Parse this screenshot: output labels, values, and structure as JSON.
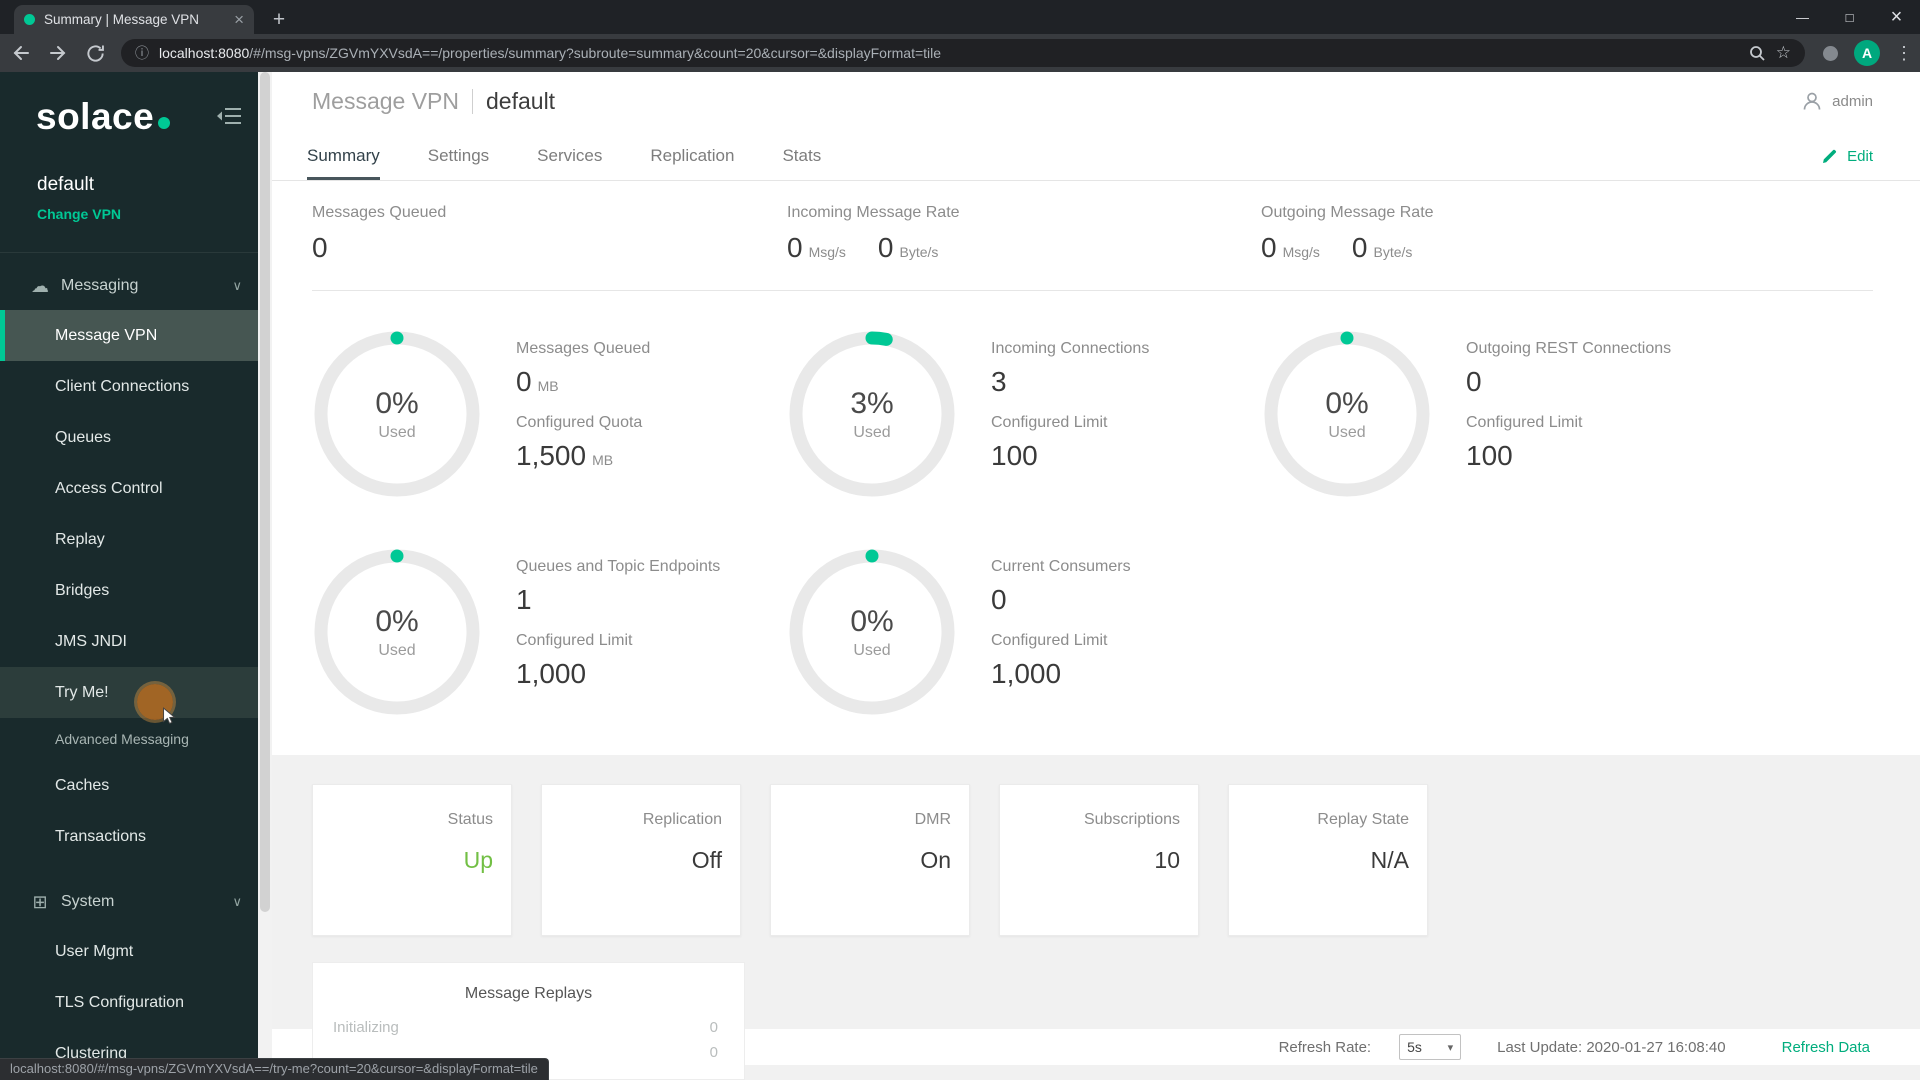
{
  "browser": {
    "tab_title": "Summary | Message VPN",
    "url_host": "localhost:8080",
    "url_path": "/#/msg-vpns/ZGVmYXVsdA==/properties/summary?subroute=summary&count=20&cursor=&displayFormat=tile",
    "avatar_letter": "A",
    "status_link": "localhost:8080/#/msg-vpns/ZGVmYXVsdA==/try-me?count=20&cursor=&displayFormat=tile"
  },
  "icons": {
    "close": "×",
    "plus": "+",
    "minimize": "—",
    "maximize": "□",
    "star": "☆",
    "menu": "⋮",
    "info": "ⓘ",
    "chevron_down": "∨",
    "cloud": "☁",
    "system_grid": "⊞",
    "dropdown_arrow": "▾"
  },
  "colors": {
    "accent": "#00c895",
    "status_up": "#72bf44"
  },
  "sidebar": {
    "logo_text": "solace",
    "vpn_name": "default",
    "change_vpn": "Change VPN",
    "messaging": {
      "label": "Messaging",
      "items": [
        "Message VPN",
        "Client Connections",
        "Queues",
        "Access Control",
        "Replay",
        "Bridges",
        "JMS JNDI",
        "Try Me!"
      ],
      "subheader": "Advanced Messaging",
      "items2": [
        "Caches",
        "Transactions"
      ]
    },
    "system": {
      "label": "System",
      "items": [
        "User Mgmt",
        "TLS Configuration",
        "Clustering"
      ]
    }
  },
  "header": {
    "title": "Message VPN",
    "vpn": "default",
    "user": "admin",
    "edit": "Edit"
  },
  "tabs": [
    {
      "label": "Summary",
      "active": true
    },
    {
      "label": "Settings",
      "active": false
    },
    {
      "label": "Services",
      "active": false
    },
    {
      "label": "Replication",
      "active": false
    },
    {
      "label": "Stats",
      "active": false
    }
  ],
  "top_metrics": {
    "queued_label": "Messages Queued",
    "queued_value": "0",
    "incoming_label": "Incoming Message Rate",
    "incoming_msg": "0",
    "incoming_msg_unit": "Msg/s",
    "incoming_byte": "0",
    "incoming_byte_unit": "Byte/s",
    "outgoing_label": "Outgoing Message Rate",
    "outgoing_msg": "0",
    "outgoing_msg_unit": "Msg/s",
    "outgoing_byte": "0",
    "outgoing_byte_unit": "Byte/s"
  },
  "gauges": [
    {
      "percent": "0%",
      "percent_num": 0,
      "used": "Used",
      "label": "Messages Queued",
      "value": "0",
      "unit": "MB",
      "limit_label": "Configured Quota",
      "limit": "1,500",
      "limit_unit": "MB"
    },
    {
      "percent": "3%",
      "percent_num": 3,
      "used": "Used",
      "label": "Incoming Connections",
      "value": "3",
      "unit": "",
      "limit_label": "Configured Limit",
      "limit": "100",
      "limit_unit": ""
    },
    {
      "percent": "0%",
      "percent_num": 0,
      "used": "Used",
      "label": "Outgoing REST Connections",
      "value": "0",
      "unit": "",
      "limit_label": "Configured Limit",
      "limit": "100",
      "limit_unit": ""
    },
    {
      "percent": "0%",
      "percent_num": 0,
      "used": "Used",
      "label": "Queues and Topic Endpoints",
      "value": "1",
      "unit": "",
      "limit_label": "Configured Limit",
      "limit": "1,000",
      "limit_unit": ""
    },
    {
      "percent": "0%",
      "percent_num": 0,
      "used": "Used",
      "label": "Current Consumers",
      "value": "0",
      "unit": "",
      "limit_label": "Configured Limit",
      "limit": "1,000",
      "limit_unit": ""
    }
  ],
  "cards": [
    {
      "label": "Status",
      "value": "Up",
      "color": "#72bf44"
    },
    {
      "label": "Replication",
      "value": "Off"
    },
    {
      "label": "DMR",
      "value": "On"
    },
    {
      "label": "Subscriptions",
      "value": "10"
    },
    {
      "label": "Replay State",
      "value": "N/A"
    }
  ],
  "replays": {
    "title": "Message Replays",
    "rows": [
      {
        "label": "Initializing",
        "value": "0"
      },
      {
        "label": "",
        "value": "0"
      }
    ]
  },
  "footer": {
    "refresh_rate_label": "Refresh Rate:",
    "refresh_rate_value": "5s",
    "last_update": "Last Update: 2020-01-27 16:08:40",
    "refresh_data": "Refresh Data"
  }
}
